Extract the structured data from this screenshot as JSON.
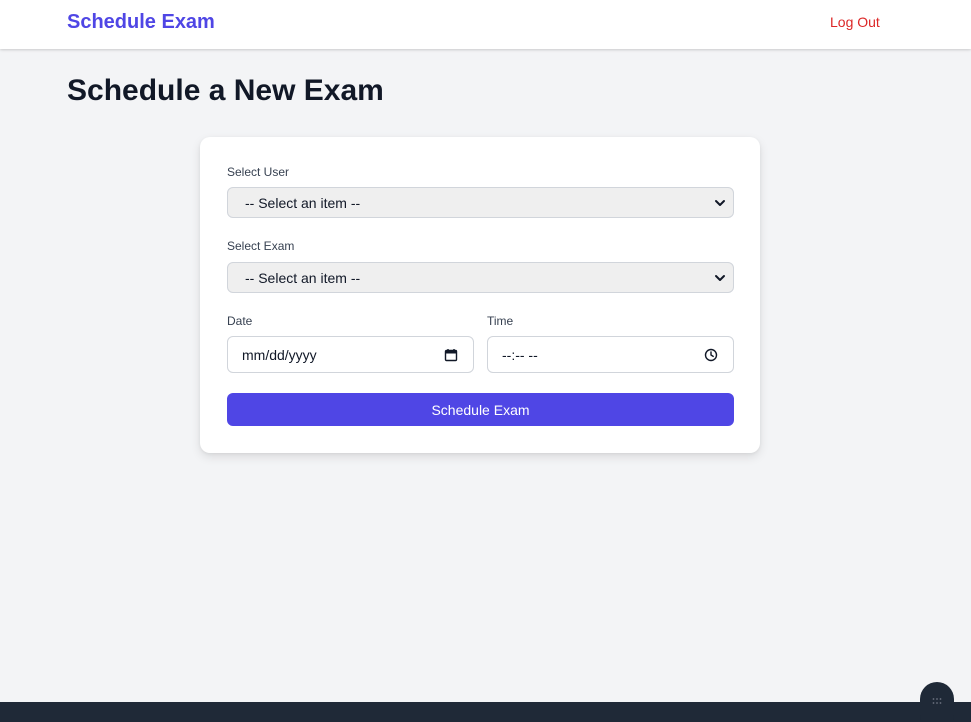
{
  "navbar": {
    "brand": "Schedule Exam",
    "logout": "Log Out"
  },
  "page": {
    "title": "Schedule a New Exam"
  },
  "form": {
    "user_label": "Select User",
    "user_value": "-- Select an item --",
    "exam_label": "Select Exam",
    "exam_value": "-- Select an item --",
    "date_label": "Date",
    "date_placeholder": "mm/dd/yyyy",
    "time_label": "Time",
    "time_placeholder": "--:-- --",
    "submit_label": "Schedule Exam"
  },
  "icons": {
    "select_user": "chevron-down-icon",
    "select_exam": "chevron-down-icon",
    "date": "calendar-icon",
    "time": "clock-icon",
    "fab": "grid-dots-icon"
  },
  "colors": {
    "brand": "#4f46e5",
    "logout": "#dc2626",
    "background": "#f3f4f6",
    "footer": "#1f2937"
  }
}
